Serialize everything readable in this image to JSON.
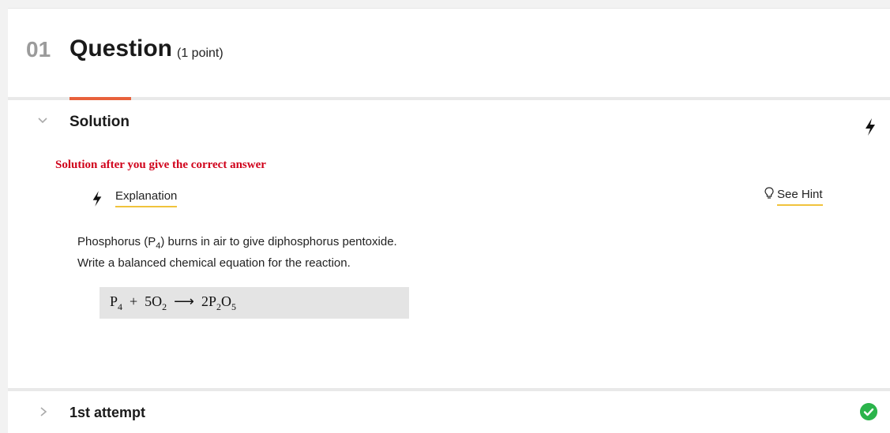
{
  "question": {
    "number": "01",
    "title": "Question",
    "points": "(1 point)"
  },
  "solution": {
    "header": "Solution",
    "note": "Solution after you give the correct answer",
    "explanation_link": "Explanation",
    "hint_link": "See Hint",
    "body_line1_before": "Phosphorus (P",
    "body_line1_sub": "4",
    "body_line1_after": ") burns in air to give diphosphorus pentoxide.",
    "body_line2": "Write a balanced chemical equation for the reaction.",
    "equation": {
      "p": "P",
      "p_sub": "4",
      "plus": "+",
      "o_coef": "5O",
      "o_sub": "2",
      "arrow": "⟶",
      "prod_coef": "2P",
      "prod_p_sub": "2",
      "prod_o": "O",
      "prod_o_sub": "5"
    }
  },
  "attempt": {
    "title": "1st attempt",
    "status": "correct"
  },
  "colors": {
    "accent": "#e8613c",
    "note_red": "#d0021b",
    "underline": "#f0c33c",
    "success": "#2bb44b"
  },
  "icons": [
    "chevron-down-icon",
    "lightning-icon",
    "lightbulb-icon",
    "chevron-right-icon",
    "check-circle-icon"
  ]
}
